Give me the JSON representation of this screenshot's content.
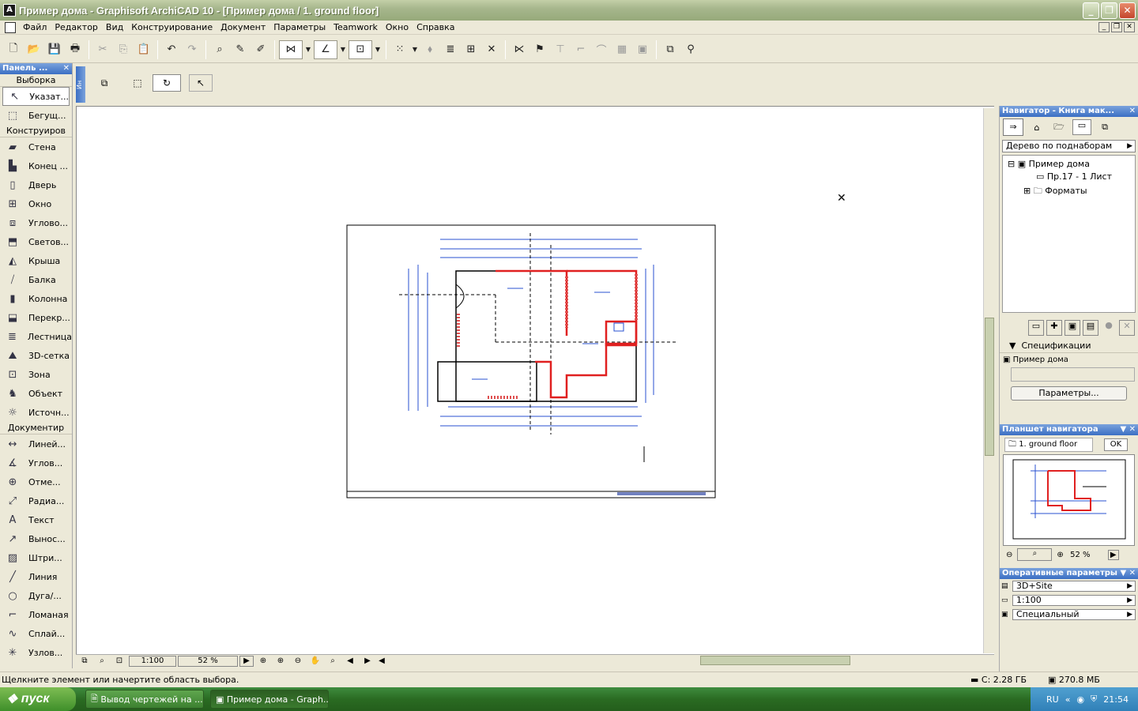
{
  "window": {
    "title": "Пример дома - Graphisoft ArchiCAD 10 - [Пример дома / 1. ground floor]"
  },
  "menu": [
    "Файл",
    "Редактор",
    "Вид",
    "Конструирование",
    "Документ",
    "Параметры",
    "Teamwork",
    "Окно",
    "Справка"
  ],
  "toolbox": {
    "title": "Панель ...",
    "select_section": "Выборка",
    "select_items": [
      {
        "label": "Указат...",
        "icon": "pointer-icon"
      },
      {
        "label": "Бегущ...",
        "icon": "marquee-icon"
      }
    ],
    "design_section": "Конструиров",
    "design_items": [
      {
        "label": "Стена",
        "icon": "wall-icon"
      },
      {
        "label": "Конец ...",
        "icon": "wall-end-icon"
      },
      {
        "label": "Дверь",
        "icon": "door-icon"
      },
      {
        "label": "Окно",
        "icon": "window-icon"
      },
      {
        "label": "Углово...",
        "icon": "corner-window-icon"
      },
      {
        "label": "Светов...",
        "icon": "skylight-icon"
      },
      {
        "label": "Крыша",
        "icon": "roof-icon"
      },
      {
        "label": "Балка",
        "icon": "beam-icon"
      },
      {
        "label": "Колонна",
        "icon": "column-icon"
      },
      {
        "label": "Перекр...",
        "icon": "slab-icon"
      },
      {
        "label": "Лестница",
        "icon": "stair-icon"
      },
      {
        "label": "3D-сетка",
        "icon": "mesh-icon"
      },
      {
        "label": "Зона",
        "icon": "zone-icon"
      },
      {
        "label": "Объект",
        "icon": "object-icon"
      },
      {
        "label": "Источн...",
        "icon": "lamp-icon"
      }
    ],
    "doc_section": "Документир",
    "doc_items": [
      {
        "label": "Линей...",
        "icon": "linear-dimension-icon"
      },
      {
        "label": "Углов...",
        "icon": "angle-dimension-icon"
      },
      {
        "label": "Отме...",
        "icon": "level-dimension-icon"
      },
      {
        "label": "Радиа...",
        "icon": "radial-dimension-icon"
      },
      {
        "label": "Текст",
        "icon": "text-icon"
      },
      {
        "label": "Вынос...",
        "icon": "label-icon"
      },
      {
        "label": "Штри...",
        "icon": "fill-icon"
      },
      {
        "label": "Линия",
        "icon": "line-icon"
      },
      {
        "label": "Дуга/...",
        "icon": "arc-icon"
      },
      {
        "label": "Ломаная",
        "icon": "polyline-icon"
      },
      {
        "label": "Сплай...",
        "icon": "spline-icon"
      },
      {
        "label": "Узлов...",
        "icon": "hotspot-icon"
      }
    ]
  },
  "infobox": {
    "label": "Ин"
  },
  "bottom": {
    "scale": "1:100",
    "zoom": "52 %"
  },
  "status": {
    "message": "Щелкните элемент или начертите область выбора.",
    "disk": "С: 2.28 ГБ",
    "memory": "270.8 МБ"
  },
  "navigator": {
    "title": "Навигатор - Книга мак...",
    "view_select": "Дерево по поднаборам",
    "tree": [
      {
        "label": "Пример дома"
      },
      {
        "label": "Пр.17 - 1 Лист"
      },
      {
        "label": "Форматы"
      }
    ],
    "spec_label": "Спецификации",
    "spec_name": "Пример дома",
    "params_button": "Параметры..."
  },
  "nav_preview": {
    "title": "Планшет навигатора",
    "view": "1. ground floor",
    "ok": "OK",
    "zoom": "52 %"
  },
  "quick_options": {
    "title": "Оперативные параметры",
    "items": [
      "3D+Site",
      "1:100",
      "Специальный"
    ]
  },
  "taskbar": {
    "start": "пуск",
    "tasks": [
      "Вывод чертежей на ...",
      "Пример дома - Graph..."
    ],
    "lang": "RU",
    "clock": "21:54"
  }
}
